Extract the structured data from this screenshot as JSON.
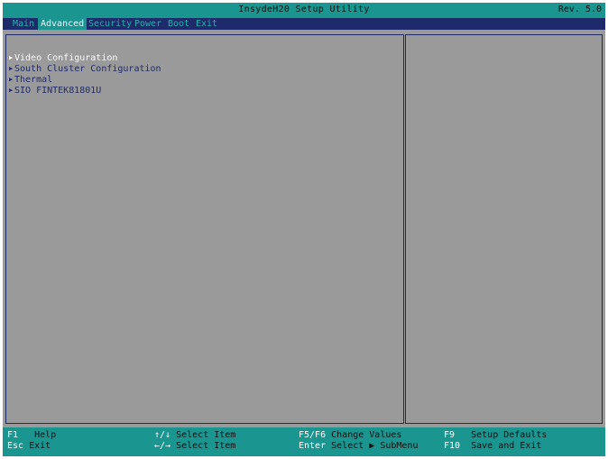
{
  "window": {
    "title": "InsydeH20 Setup Utility",
    "revision": "Rev. 5.0"
  },
  "menu": [
    {
      "label": "Main",
      "active": false
    },
    {
      "label": "Advanced",
      "active": true
    },
    {
      "label": "Security",
      "active": false
    },
    {
      "label": "Power",
      "active": false
    },
    {
      "label": "Boot",
      "active": false
    },
    {
      "label": "Exit",
      "active": false
    }
  ],
  "entries": [
    {
      "label": "Video Configuration",
      "selected": true
    },
    {
      "label": "South Cluster Configuration",
      "selected": false
    },
    {
      "label": "Thermal",
      "selected": false
    },
    {
      "label": "SIO FINTEK81801U",
      "selected": false
    }
  ],
  "footer": [
    {
      "key": "F1",
      "desc": "Help"
    },
    {
      "key": "Esc",
      "desc": "Exit"
    },
    {
      "key": "↑/↓",
      "desc": "Select Item"
    },
    {
      "key": "←/→",
      "desc": "Select Item"
    },
    {
      "key": "F5/F6",
      "desc": "Change Values"
    },
    {
      "key": "Enter",
      "desc": "Select ▶ SubMenu"
    },
    {
      "key": "F9",
      "desc": "Setup Defaults"
    },
    {
      "key": "F10",
      "desc": "Save and Exit"
    }
  ],
  "icons": {
    "submenu_arrow": "submenu-arrow-icon"
  },
  "colors": {
    "title_bar": "#1a958f",
    "menu_bar": "#1f2a6b",
    "content_bg": "#9a9a9a",
    "selected_text": "#ffffff",
    "entry_text": "#1f2a6b"
  }
}
